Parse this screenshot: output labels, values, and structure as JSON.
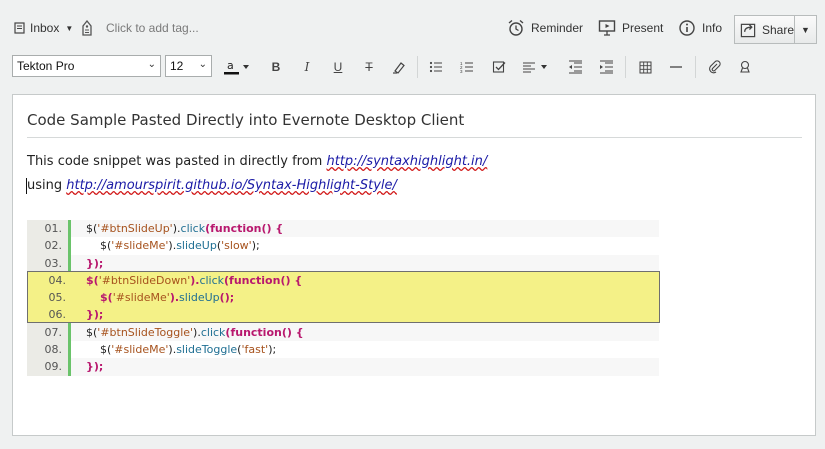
{
  "topbar": {
    "notebook": "Inbox",
    "tag_placeholder": "Click to add tag...",
    "reminder": "Reminder",
    "present": "Present",
    "info": "Info",
    "share": "Share"
  },
  "format": {
    "font": "Tekton Pro",
    "size": "12"
  },
  "note": {
    "title": "Code Sample Pasted Directly into Evernote Desktop Client",
    "line1_text": "This code snippet was pasted in directly from ",
    "line1_link": "http://syntaxhighlight.in/",
    "line2_text": "using ",
    "line2_link": "http://amourspirit.github.io/Syntax-Highlight-Style/"
  },
  "code": {
    "lines": [
      {
        "num": "01.",
        "text": "$('#btnSlideUp').click(function() {"
      },
      {
        "num": "02.",
        "text": "$('#slideMe').slideUp('slow');"
      },
      {
        "num": "03.",
        "text": "});"
      },
      {
        "num": "04.",
        "text": "$('#btnSlideDown').click(function() {"
      },
      {
        "num": "05.",
        "text": "$('#slideMe').slideUp();"
      },
      {
        "num": "06.",
        "text": "});"
      },
      {
        "num": "07.",
        "text": "$('#btnSlideToggle').click(function() {"
      },
      {
        "num": "08.",
        "text": "$('#slideMe').slideToggle('fast');"
      },
      {
        "num": "09.",
        "text": "});"
      }
    ]
  },
  "colors": {
    "highlight": "#f4f187",
    "gutter_accent": "#6ac36a",
    "keyword": "#b8186e",
    "string": "#a6521d"
  }
}
